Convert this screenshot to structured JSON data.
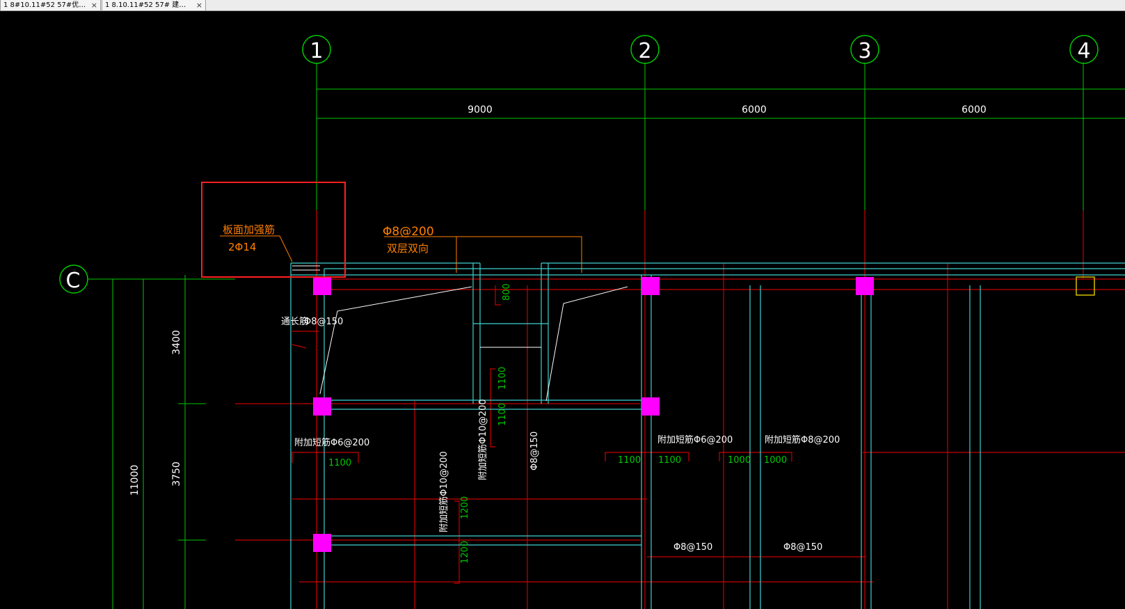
{
  "tabs": [
    {
      "label": "1 8#10.11#52 57#优…",
      "active": true
    },
    {
      "label": "1 8.10.11#52 57# 建…",
      "active": false
    }
  ],
  "axes": {
    "vertical": [
      "1",
      "2",
      "3",
      "4"
    ],
    "horizontal": [
      "C"
    ]
  },
  "dimensions": {
    "top": [
      "9000",
      "6000",
      "6000"
    ],
    "left_total": "11000",
    "left_parts": [
      "3400",
      "3750"
    ]
  },
  "highlight_box": {
    "line1": "板面加强筋",
    "line2": "2Φ14"
  },
  "slab_rebar": {
    "spec": "Φ8@200",
    "note": "双层双向"
  },
  "annotations": {
    "corner_bar": "Φ8@150",
    "corner_bar_prefix": "通长筋",
    "add_left": "附加短筋Φ6@200",
    "add_left_len": "1100",
    "add_vert": "附加短筋Φ10@200",
    "add_vert2": "附加短筋Φ10@200",
    "vert_150": "Φ8@150",
    "len_800": "800",
    "len_1100a": "1100",
    "len_1100b": "1100",
    "len_1200a": "1200",
    "len_1200b": "1200",
    "add_mid1": "附加短筋Φ6@200",
    "add_mid1_l": "1100",
    "add_mid1_r": "1100",
    "add_mid2": "附加短筋Φ8@200",
    "add_mid2_l": "1000",
    "add_mid2_r": "1000",
    "bottom1": "Φ8@150",
    "bottom2": "Φ8@150"
  },
  "colors": {
    "background": "#000000",
    "axis_green": "#00c800",
    "wall_cyan": "#40d0d0",
    "beam_red": "#c80000",
    "annotation_orange": "#ff8000",
    "column_magenta": "#ff00ff",
    "highlight_red": "#ff2020"
  }
}
